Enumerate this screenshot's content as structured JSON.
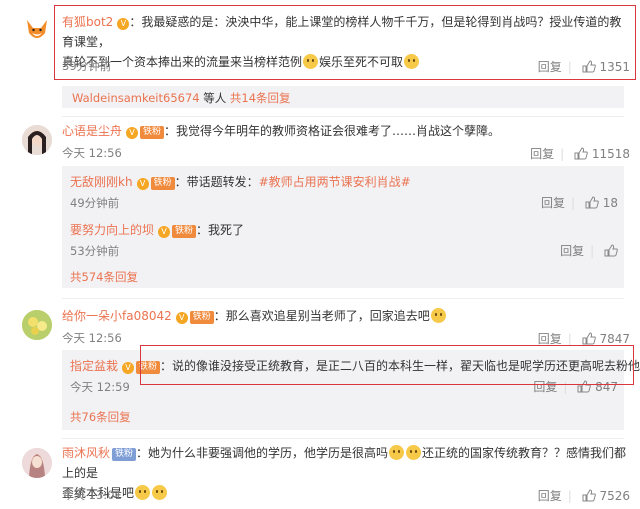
{
  "comments": [
    {
      "user": "有狐bot2",
      "text": "：我最疑惑的是：泱泱中华，能上课堂的榜样人物千千万，但是轮得到肖战吗？授业传道的教育课堂，",
      "text2": "真轮不到一个资本捧出来的流量来当榜样范例",
      "text3": "娱乐至死不可取",
      "time": "39分钟前",
      "reply": "回复",
      "likes": "1351"
    },
    {
      "user": "心语是尘舟",
      "fan_badge": "铁粉",
      "text": "：我觉得今年明年的教师资格证会很难考了……肖战这个孽障。",
      "time": "今天 12:56",
      "reply": "回复",
      "likes": "11518"
    },
    {
      "user": "给你一朵小fa08042",
      "fan_badge": "铁粉",
      "text": "：那么喜欢追星别当老师了，回家追去吧",
      "time": "今天 12:56",
      "reply": "回复",
      "likes": "7847"
    },
    {
      "user": "雨沐风秋",
      "fan_badge": "铁粉",
      "text": "：她为什么非要强调他的学历，他学历是很高吗",
      "text_mid": "还正统的国家传统教育？？感情我们都上的是",
      "text2": "歪统本科是吧",
      "time": "今天 13:01",
      "reply": "回复",
      "likes": "7526"
    }
  ],
  "subreply_summary_1": {
    "users": "Waldeinsamkeit65674",
    "suffix": "等人",
    "count_text": "共14条回复"
  },
  "subreplies_2": [
    {
      "user": "无敌刚刚kh",
      "fan_badge": "铁粉",
      "text": "：带话题转发：",
      "tag": "#教师占用两节课安利肖战#",
      "time": "49分钟前",
      "reply": "回复",
      "likes": "18"
    },
    {
      "user": "要努力向上的坝",
      "fan_badge": "铁粉",
      "text": "：我死了",
      "time": "53分钟前",
      "reply": "回复",
      "likes": ""
    }
  ],
  "more_2": "共574条回复",
  "subreplies_3": [
    {
      "user": "指定盆栽",
      "fan_badge": "铁粉",
      "text": "：说的像谁没接受正统教育，是正二八百的本科生一样，翟天临也是呢学历还更高呢去粉他吧",
      "time": "今天 12:59",
      "reply": "回复",
      "likes": "847"
    }
  ],
  "more_3": "共76条回复",
  "colors": {
    "accent": "#eb7350",
    "highlight_box": "#d9363e",
    "reply_bg": "#f2f2f5"
  }
}
